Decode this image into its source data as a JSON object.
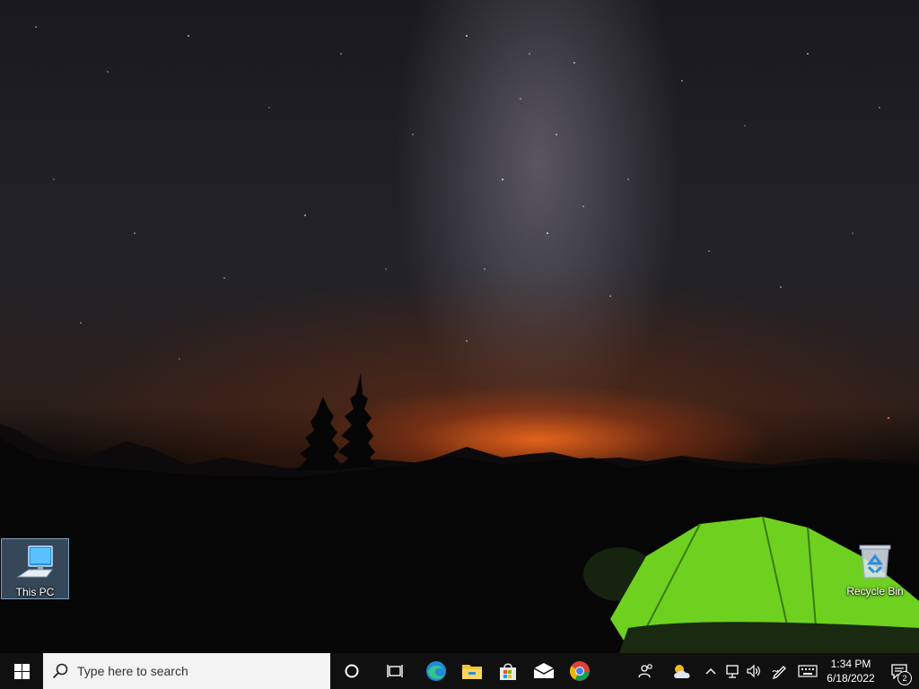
{
  "desktop": {
    "icons": [
      {
        "label": "This PC"
      },
      {
        "label": "Recycle Bin"
      }
    ]
  },
  "taskbar": {
    "search": {
      "placeholder": "Type here to search"
    },
    "pinned": [
      "cortana-icon",
      "task-view-icon",
      "edge-icon",
      "file-explorer-icon",
      "microsoft-store-icon",
      "mail-icon",
      "chrome-icon"
    ],
    "tray": {
      "time": "1:34 PM",
      "date": "6/18/2022",
      "notification_count": "2"
    }
  }
}
